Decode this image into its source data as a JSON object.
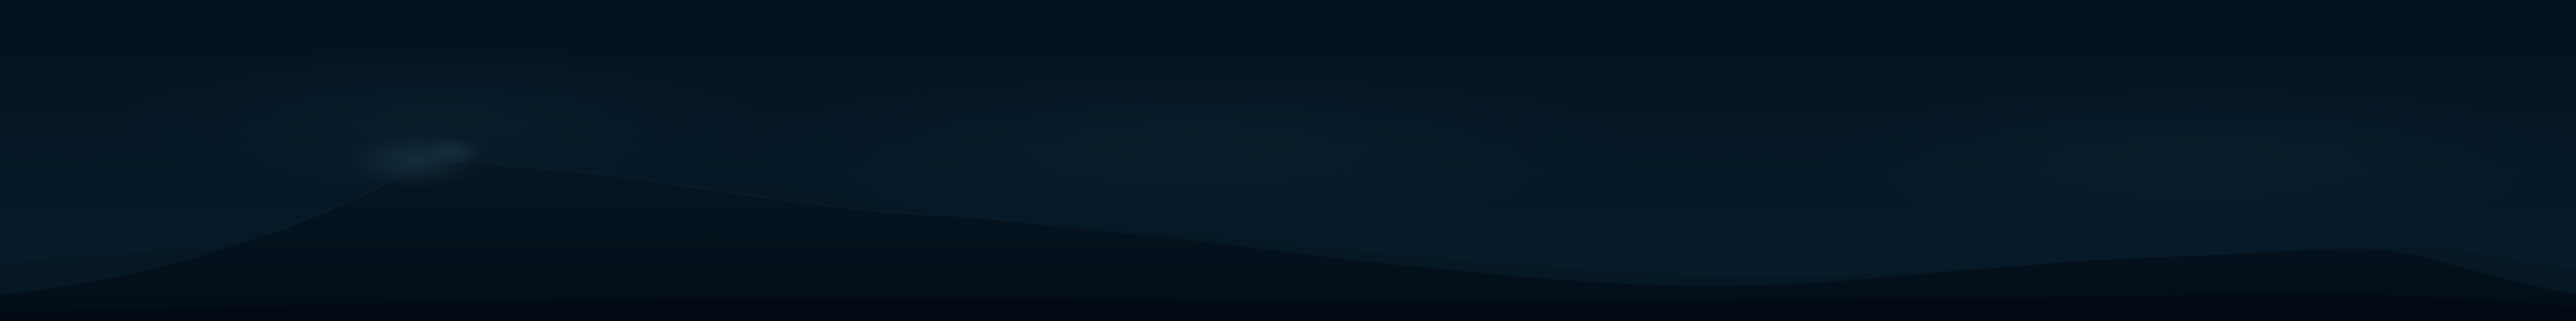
{
  "scene": {
    "description_kind": "night-panorama",
    "elements": [
      "night-sky",
      "mountain-ridge",
      "snowy-peak-highlight",
      "distant-hills"
    ],
    "colors": {
      "sky_top": "#04111f",
      "sky_mid": "#051827",
      "sky_bottom": "#071b2b",
      "haze": "#0b2230",
      "ridge": "#020d17",
      "ridge_edge": "#0a1d2a",
      "foreground": "#010a12",
      "peak_highlight": "#183444"
    }
  }
}
